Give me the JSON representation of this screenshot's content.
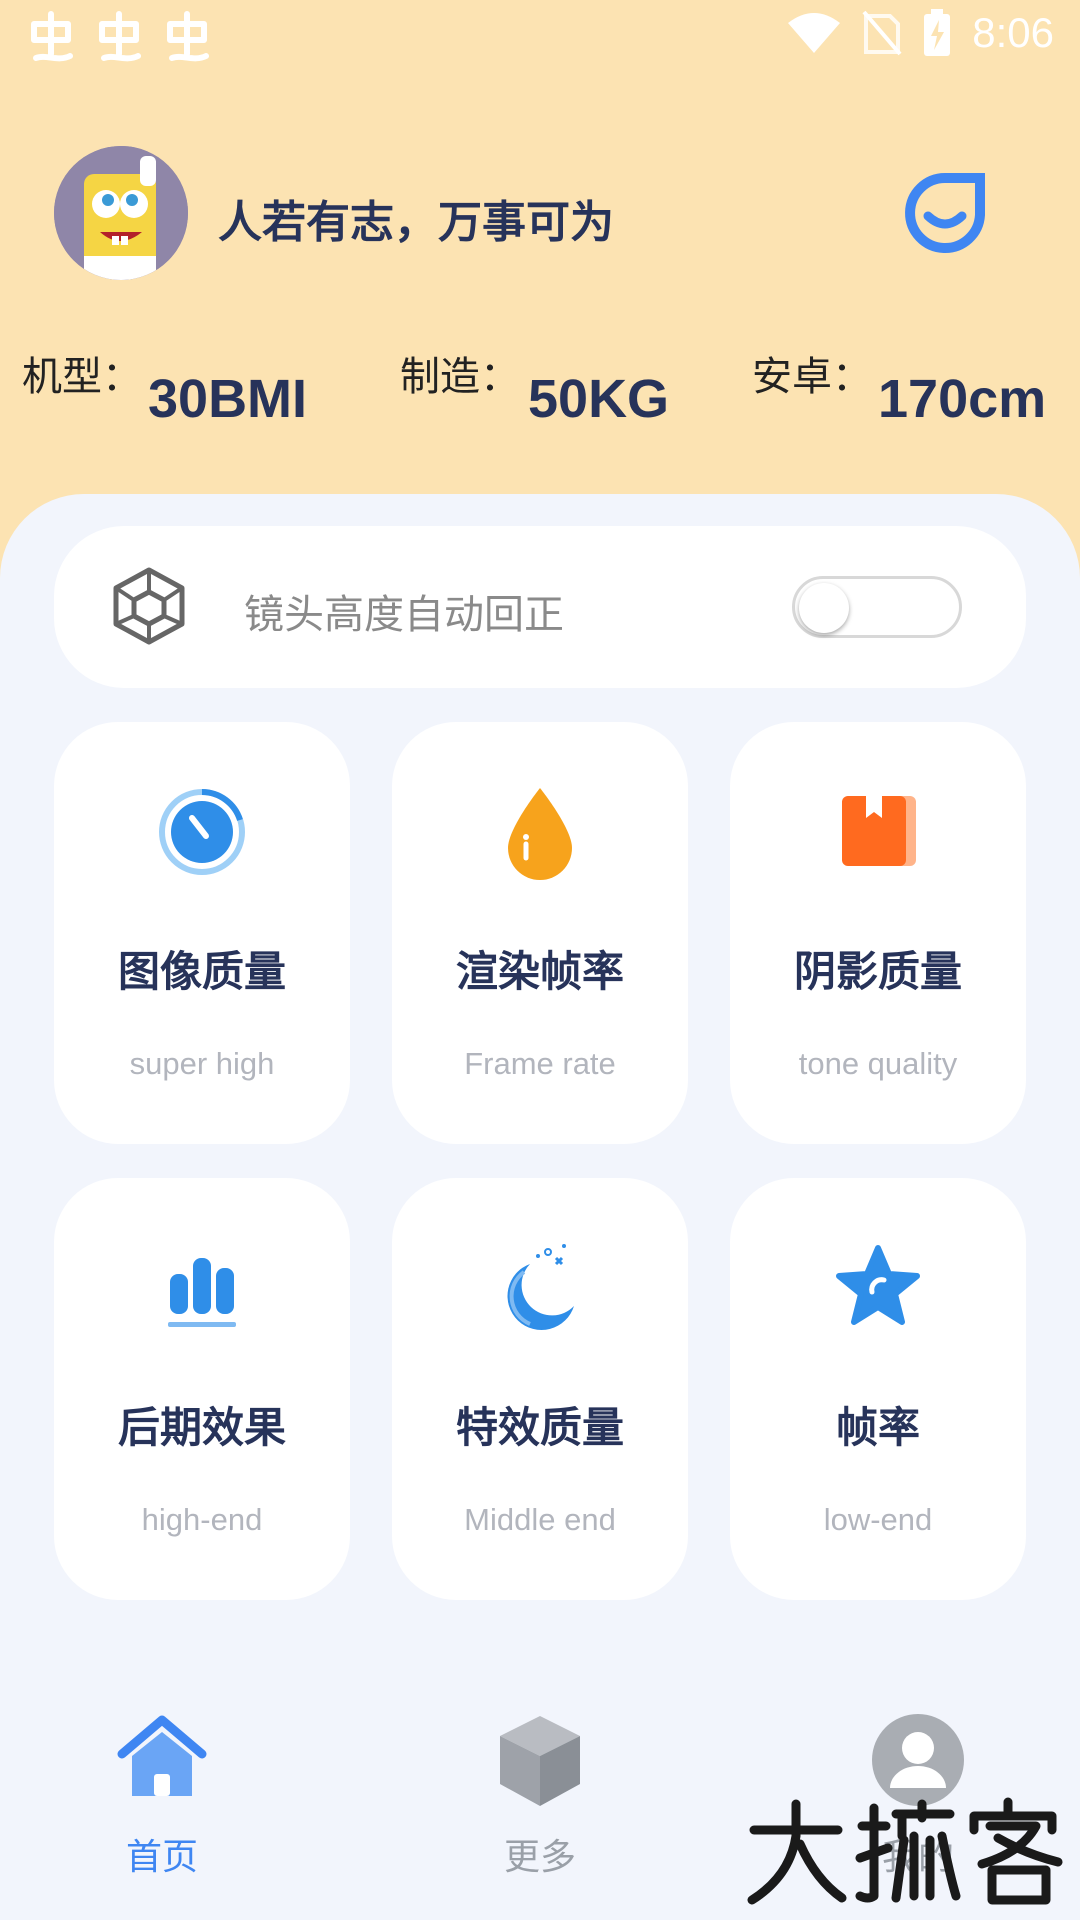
{
  "status_bar": {
    "time": "8:06",
    "left_icons": [
      "notification-glyph-icon",
      "notification-glyph-icon",
      "notification-glyph-icon"
    ],
    "right_icons": [
      "wifi-icon",
      "no-sim-icon",
      "battery-charging-icon"
    ]
  },
  "header": {
    "motto": "人若有志，万事可为",
    "stats": [
      {
        "label": "机型：",
        "value": "30BMI"
      },
      {
        "label": "制造：",
        "value": "50KG"
      },
      {
        "label": "安卓：",
        "value": "170cm"
      }
    ]
  },
  "auto_correct": {
    "label": "镜头高度自动回正",
    "enabled": false
  },
  "tiles": [
    {
      "title": "图像质量",
      "subtitle": "super high",
      "icon": "gauge-icon",
      "color": "#2f8ee8"
    },
    {
      "title": "渲染帧率",
      "subtitle": "Frame rate",
      "icon": "drop-icon",
      "color": "#f7a31c"
    },
    {
      "title": "阴影质量",
      "subtitle": "tone quality",
      "icon": "book-icon",
      "color": "#ff6a1f"
    },
    {
      "title": "后期效果",
      "subtitle": "high-end",
      "icon": "bar-chart-icon",
      "color": "#2f8ee8"
    },
    {
      "title": "特效质量",
      "subtitle": "Middle end",
      "icon": "moon-icon",
      "color": "#2f8ee8"
    },
    {
      "title": "帧率",
      "subtitle": "low-end",
      "icon": "star-icon",
      "color": "#2f8ee8"
    }
  ],
  "nav": [
    {
      "label": "首页",
      "active": true,
      "color": "#3f86f2"
    },
    {
      "label": "更多",
      "active": false,
      "color": "#9aa0a8"
    },
    {
      "label": "我的",
      "active": false,
      "color": "#9aa0a8"
    }
  ],
  "colors": {
    "header_bg": "#fce3b2",
    "page_bg": "#f2f5fc",
    "title_text": "#27335a",
    "accent": "#3f86f2"
  }
}
